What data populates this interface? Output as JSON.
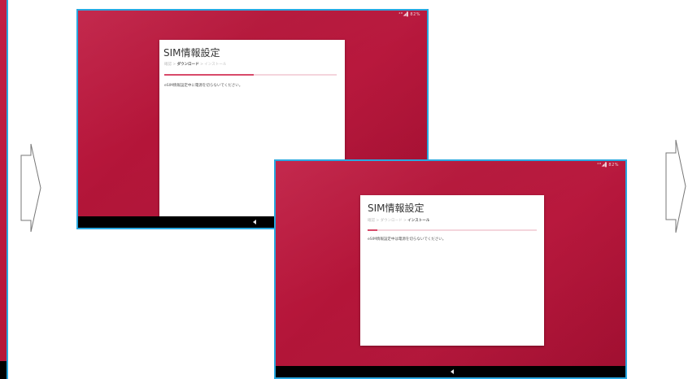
{
  "accent_color": "#29a8e0",
  "brand_color": "#b8183d",
  "screen1": {
    "status_text": "⁴ᴳ◢▌82%",
    "title": "SIM情報設定",
    "step_1": "確認",
    "step_sep": " > ",
    "step_2": "ダウンロード",
    "step_3": "インストール",
    "message": "eSIM情報設定中に電源を切らないでください。",
    "progress": 0.52
  },
  "screen2": {
    "status_text": "⁴ᴳ◢▌82%",
    "title": "SIM情報設定",
    "step_1": "確認",
    "step_sep": " > ",
    "step_2": "ダウンロード",
    "step_3": "インストール",
    "message": "eSIM情報設定中は電源を切らないでください。",
    "progress": 0.06
  },
  "icons": {
    "arrow_left": "right-arrow-icon",
    "arrow_right": "right-arrow-icon",
    "back": "back-icon"
  }
}
